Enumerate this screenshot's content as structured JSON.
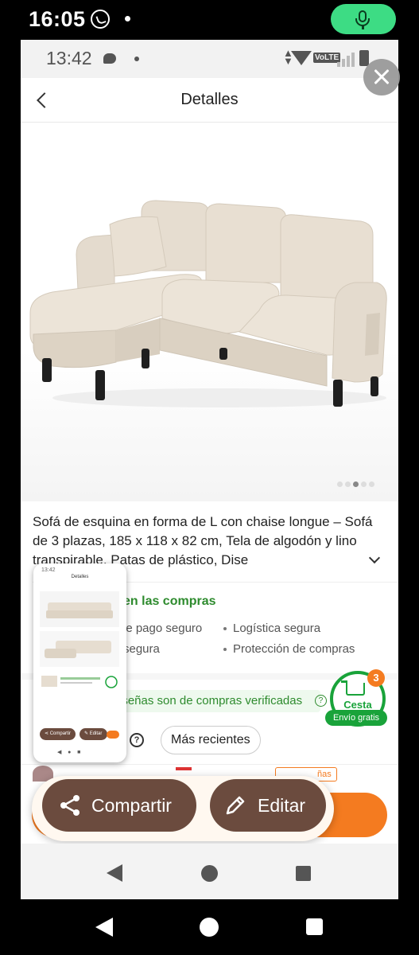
{
  "outer_status": {
    "time": "16:05"
  },
  "inner_status": {
    "time": "13:42",
    "network": "VoLTE"
  },
  "header": {
    "title": "Detalles"
  },
  "product": {
    "title": "Sofá de esquina en forma de L con chaise longue – Sofá de 3 plazas, 185 x 118 x 82 cm, Tela de algodón y lino transpirable, Patas de plástico, Dise",
    "image_count": 5,
    "active_image": 3
  },
  "trust": {
    "title": "en las compras",
    "items": [
      "le pago seguro",
      "Logística segura",
      "segura",
      "Protección de compras"
    ]
  },
  "reviews": {
    "verified_text": "reseñas son de compras verificadas",
    "help_glyph": "?",
    "filters": [
      "Más recientes"
    ],
    "tag_partial": "ñas"
  },
  "cart": {
    "count": "3",
    "label": "Cesta",
    "shipping": "Envío gratis"
  },
  "share_overlay": {
    "share_label": "Compartir",
    "edit_label": "Editar"
  },
  "thumbnail": {
    "time": "13:42",
    "title": "Detalles",
    "share_label": "Compartir",
    "edit_label": "Editar"
  },
  "colors": {
    "accent_orange": "#f47b20",
    "trust_green": "#2e8b2e",
    "share_brown": "#6b4b3e",
    "cart_green": "#19a33a"
  }
}
